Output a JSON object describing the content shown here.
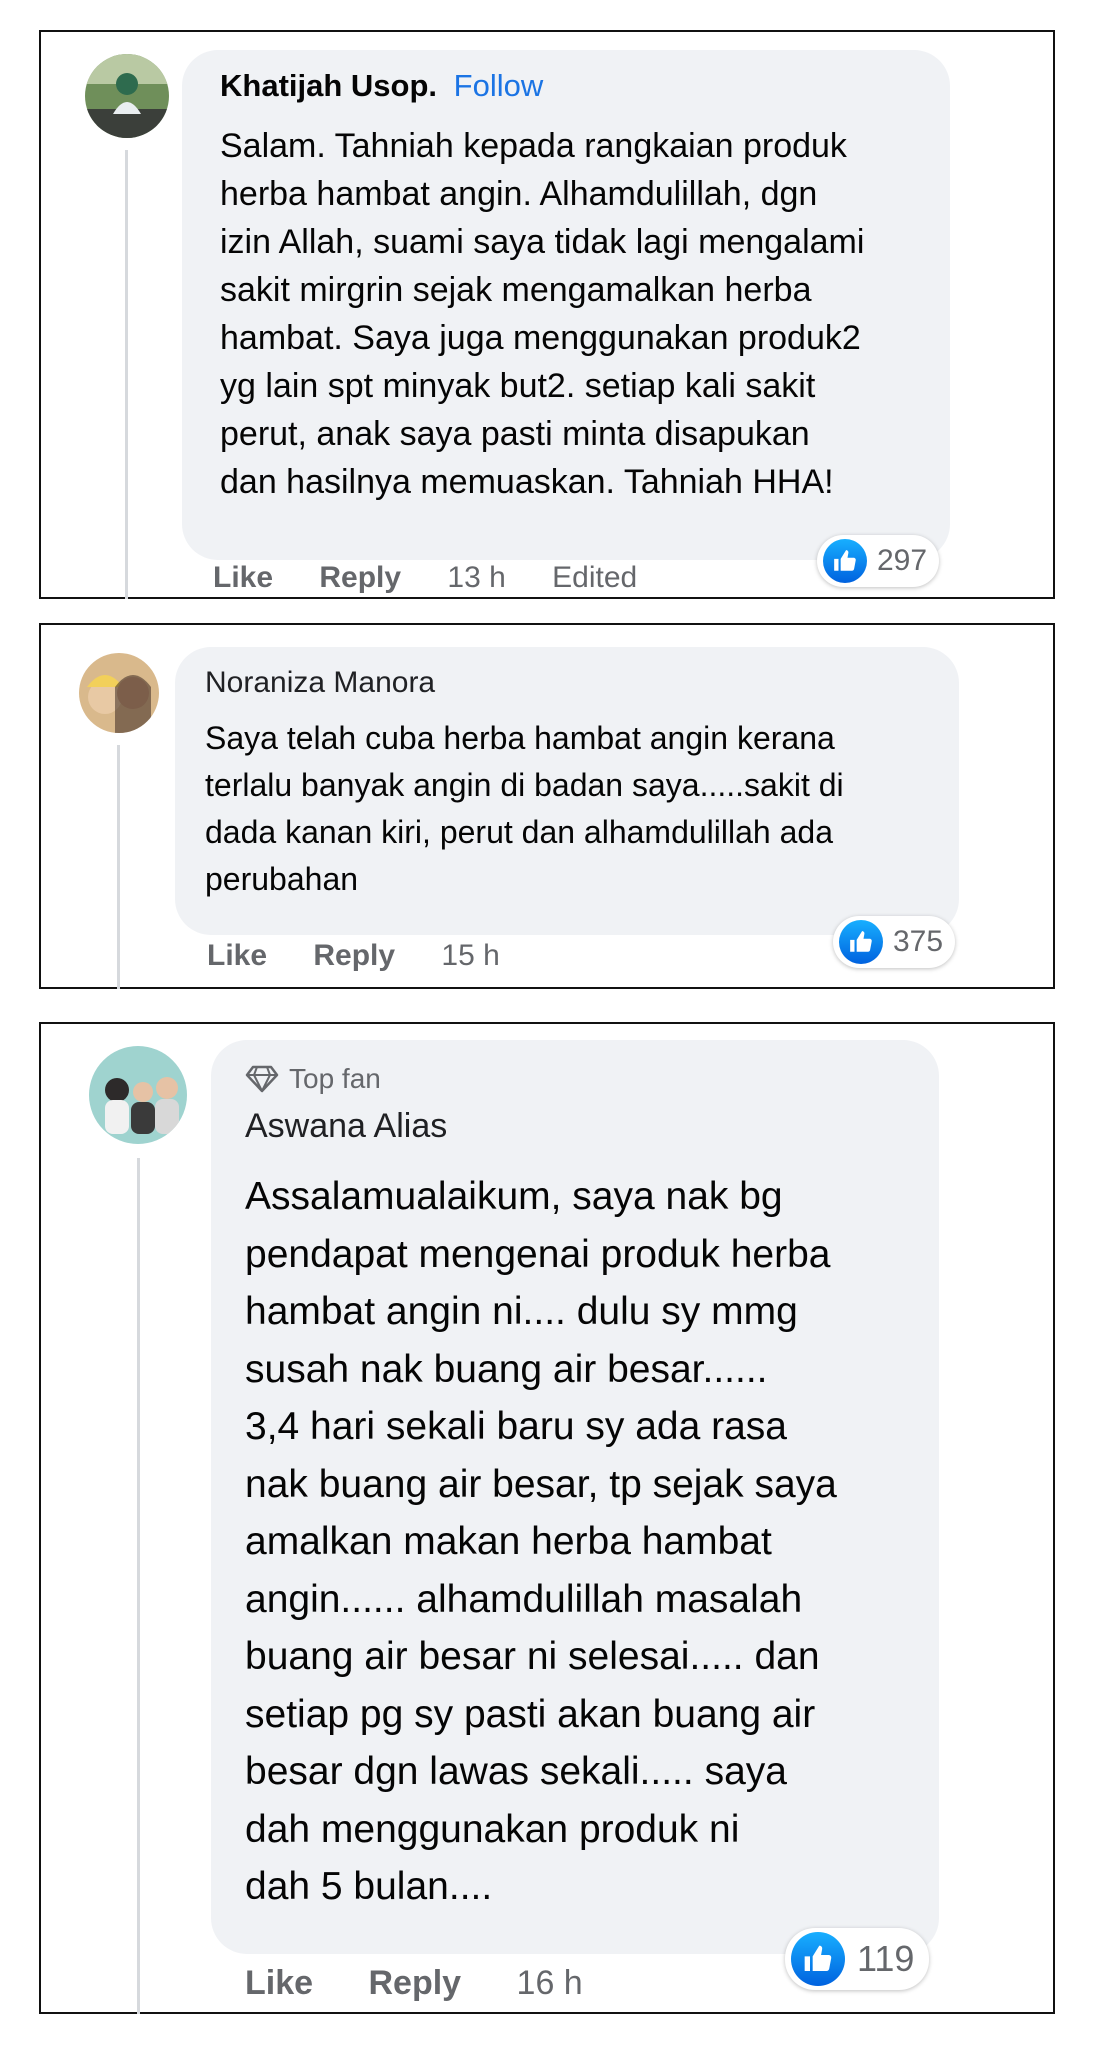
{
  "comments": [
    {
      "author": "Khatijah Usop.",
      "follow_label": "Follow",
      "text": "Salam. Tahniah kepada rangkaian produk\nherba hambat angin. Alhamdulillah, dgn\nizin Allah, suami saya tidak lagi mengalami\nsakit mirgrin sejak mengamalkan herba\nhambat. Saya juga menggunakan produk2\nyg lain spt minyak but2. setiap kali sakit\nperut, anak saya pasti minta disapukan\ndan hasilnya memuaskan. Tahniah HHA!",
      "like_label": "Like",
      "reply_label": "Reply",
      "time": "13 h",
      "edited_label": "Edited",
      "reaction_count": "297"
    },
    {
      "author": "Noraniza Manora",
      "text": "Saya telah cuba herba hambat angin kerana\nterlalu banyak angin di badan saya.....sakit di\ndada kanan kiri, perut dan alhamdulillah ada\nperubahan",
      "like_label": "Like",
      "reply_label": "Reply",
      "time": "15 h",
      "reaction_count": "375"
    },
    {
      "badge_label": "Top fan",
      "author": "Aswana Alias",
      "text": "Assalamualaikum, saya nak bg\npendapat mengenai produk herba\nhambat angin ni.... dulu sy mmg\nsusah nak buang air besar......\n3,4 hari sekali baru sy ada rasa\nnak buang air besar, tp sejak saya\namalkan makan herba hambat\nangin...... alhamdulillah masalah\nbuang air besar ni selesai..... dan\nsetiap pg sy pasti akan buang air\nbesar dgn lawas sekali..... saya\ndah menggunakan produk ni\ndah 5 bulan....",
      "like_label": "Like",
      "reply_label": "Reply",
      "time": "16 h",
      "reaction_count": "119"
    }
  ],
  "colors": {
    "bubble": "#f0f2f5",
    "link": "#1b74e4",
    "muted": "#65676b",
    "like_blue": "#0866ff"
  }
}
